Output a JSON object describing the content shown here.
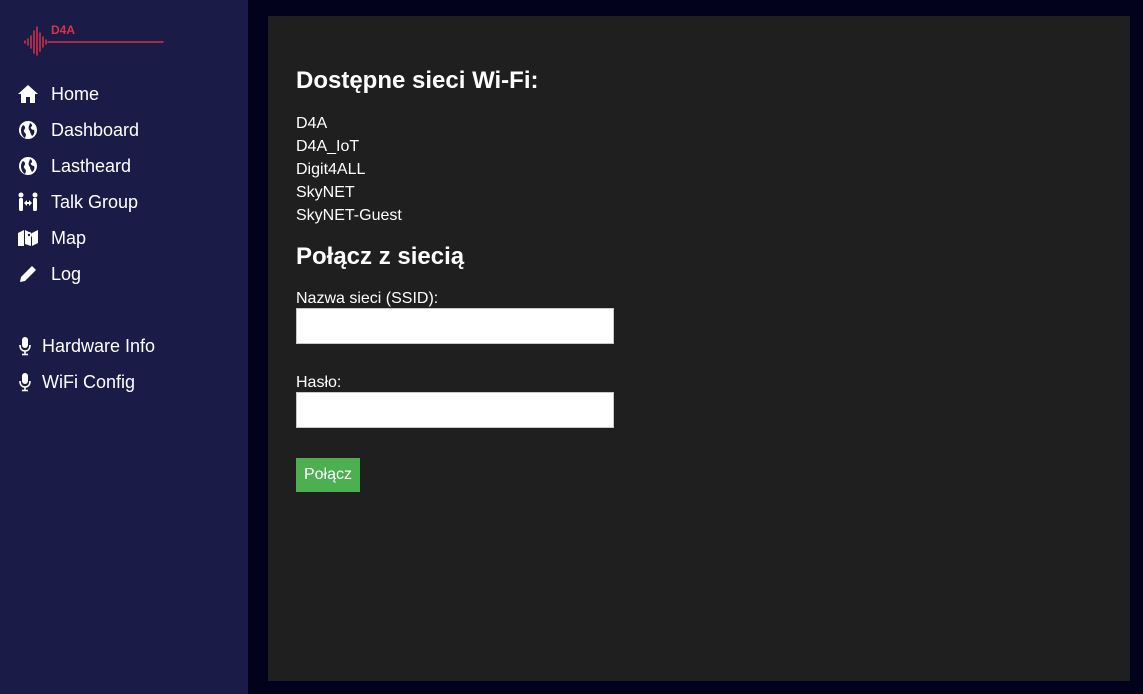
{
  "logo": {
    "text": "D4A",
    "color": "#d6334a"
  },
  "sidebar": {
    "items": [
      {
        "label": "Home",
        "icon": "home-icon"
      },
      {
        "label": "Dashboard",
        "icon": "globe-icon"
      },
      {
        "label": "Lastheard",
        "icon": "globe-icon"
      },
      {
        "label": "Talk Group",
        "icon": "people-arrows-icon"
      },
      {
        "label": "Map",
        "icon": "map-icon"
      },
      {
        "label": "Log",
        "icon": "pencil-icon"
      },
      {
        "label": "Hardware Info",
        "icon": "microphone-icon"
      },
      {
        "label": "WiFi Config",
        "icon": "microphone-icon"
      }
    ]
  },
  "main": {
    "networks_title": "Dostępne sieci Wi-Fi:",
    "networks": [
      "D4A",
      "D4A_IoT",
      "Digit4ALL",
      "SkyNET",
      "SkyNET-Guest"
    ],
    "connect_title": "Połącz z siecią",
    "ssid_label": "Nazwa sieci (SSID):",
    "ssid_value": "",
    "password_label": "Hasło:",
    "password_value": "",
    "connect_button": "Połącz"
  },
  "colors": {
    "page_bg": "#02021c",
    "sidebar_bg": "#1b1b47",
    "content_bg": "#1f1f1f",
    "button_bg": "#4caf50"
  }
}
